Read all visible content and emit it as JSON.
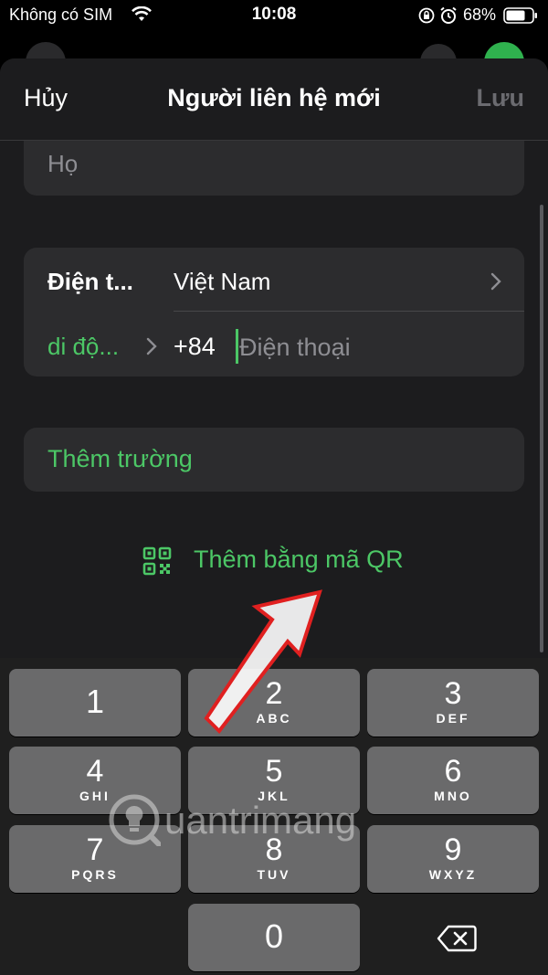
{
  "status_bar": {
    "carrier": "Không có SIM",
    "time": "10:08",
    "battery_percent": "68%",
    "icons": [
      "wifi-icon",
      "orientation-lock-icon",
      "alarm-icon",
      "battery-icon"
    ]
  },
  "nav": {
    "cancel_label": "Hủy",
    "title": "Người liên hệ mới",
    "save_label": "Lưu"
  },
  "form": {
    "last_name_placeholder": "Họ",
    "phone": {
      "label": "Điện t...",
      "country": "Việt Nam",
      "type": "di độ...",
      "prefix": "+84",
      "placeholder": "Điện thoại",
      "value": ""
    },
    "add_field_label": "Thêm trường",
    "add_qr_label": "Thêm bằng mã QR"
  },
  "keypad": {
    "keys": [
      {
        "num": "1",
        "letters": ""
      },
      {
        "num": "2",
        "letters": "ABC"
      },
      {
        "num": "3",
        "letters": "DEF"
      },
      {
        "num": "4",
        "letters": "GHI"
      },
      {
        "num": "5",
        "letters": "JKL"
      },
      {
        "num": "6",
        "letters": "MNO"
      },
      {
        "num": "7",
        "letters": "PQRS"
      },
      {
        "num": "8",
        "letters": "TUV"
      },
      {
        "num": "9",
        "letters": "WXYZ"
      },
      {
        "num": "0",
        "letters": ""
      }
    ]
  },
  "watermark": {
    "text": "uantrimang"
  },
  "colors": {
    "accent_green": "#4cc766",
    "sheet_bg": "#1c1c1e",
    "card_bg": "#2c2c2e",
    "key_bg": "#6a6a6b",
    "annotation_red": "#e02020"
  }
}
